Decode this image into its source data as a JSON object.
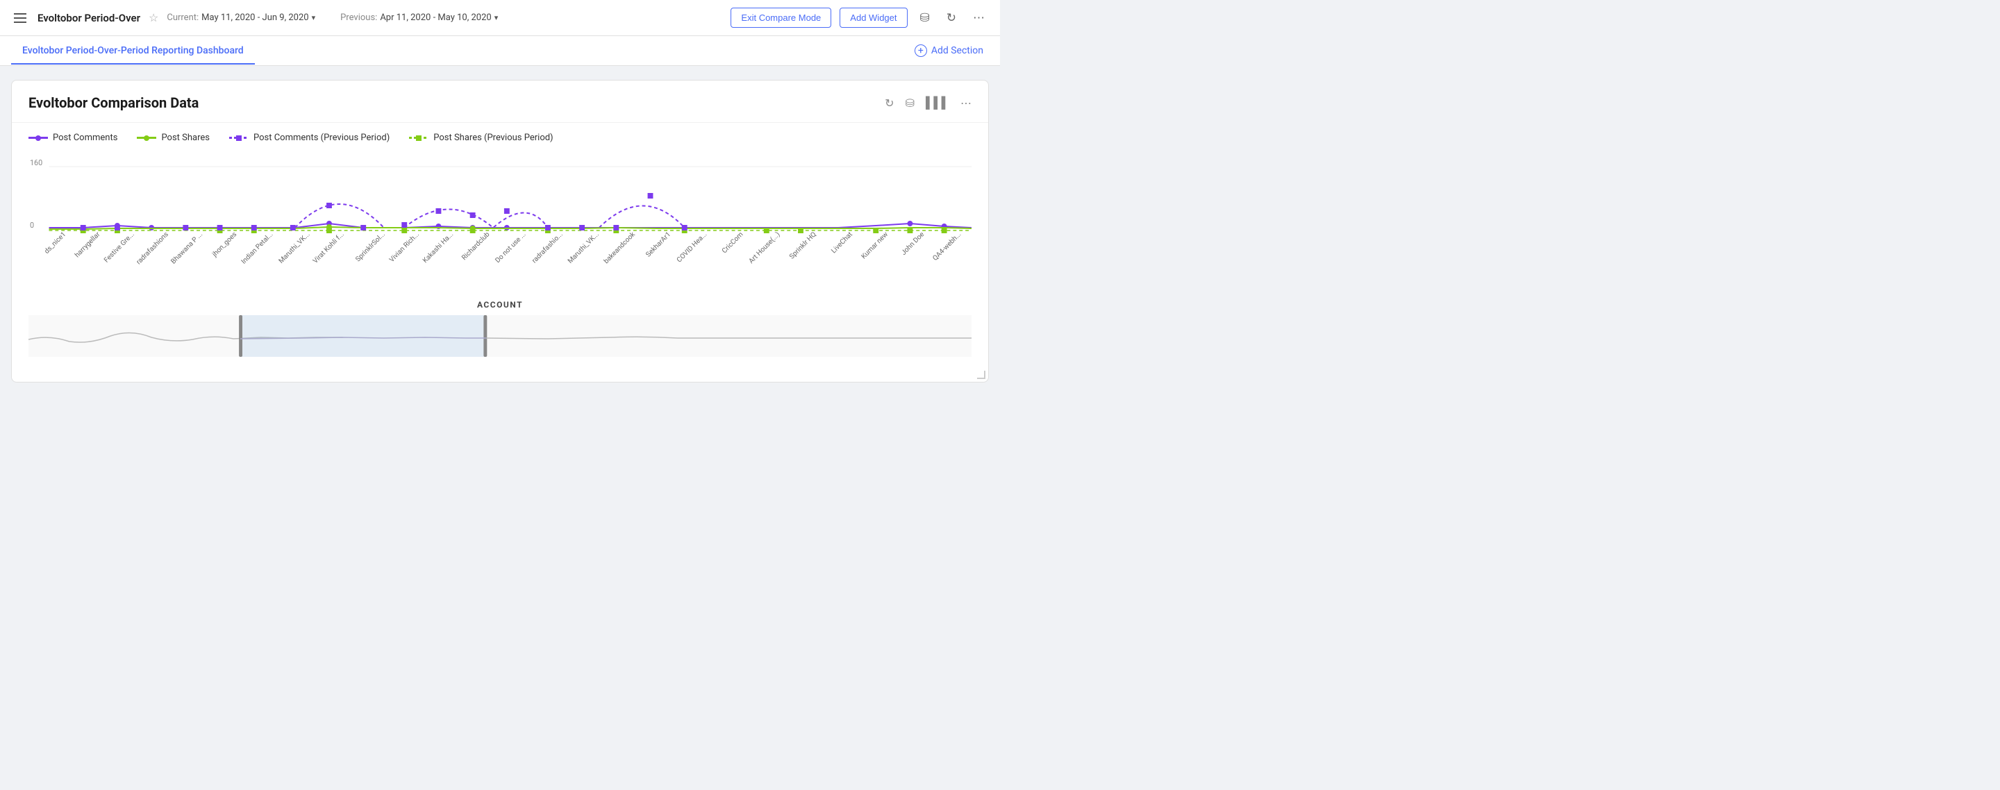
{
  "header": {
    "hamburger": "☰",
    "title": "Evoltobor Period-Over",
    "star": "☆",
    "current_label": "Current:",
    "current_date": "May 11, 2020 - Jun 9, 2020",
    "previous_label": "Previous:",
    "previous_date": "Apr 11, 2020 - May 10, 2020",
    "btn_exit": "Exit Compare Mode",
    "btn_add_widget": "Add Widget"
  },
  "tab_bar": {
    "tab_label": "Evoltobor Period-Over-Period Reporting Dashboard",
    "add_section": "Add Section"
  },
  "chart": {
    "title": "Evoltobor Comparison Data",
    "legend": [
      {
        "key": "post_comments",
        "label": "Post Comments",
        "type": "purple-solid"
      },
      {
        "key": "post_shares",
        "label": "Post Shares",
        "type": "green-solid"
      },
      {
        "key": "post_comments_prev",
        "label": "Post Comments (Previous Period)",
        "type": "purple-dashed"
      },
      {
        "key": "post_shares_prev",
        "label": "Post Shares (Previous Period)",
        "type": "green-dashed"
      }
    ],
    "y_axis_label": "160",
    "y_axis_zero": "0",
    "x_axis_label": "ACCOUNT",
    "x_labels": [
      "ds_nice1",
      "harrygellar",
      "Festive Gre...",
      "radrafashions",
      "Bhawana P ...",
      "jhon_goes",
      "Indian Petal...",
      "Maruthi_VK...",
      "Virat Kohli f...",
      "SprinklrSol...",
      "Vivian Rich...",
      "Kakashi Ha...",
      "Richardclub",
      "Do not use ...",
      "radrafashio...",
      "Maruthi_VK...",
      "bakeandcook",
      "SekharAr1",
      "COVID Hea...",
      "CricCom",
      "Art House(...)",
      "Sprinklr HQ",
      "LiveChat",
      "Kumar new",
      "John Doe",
      "QA4-webh..."
    ]
  }
}
